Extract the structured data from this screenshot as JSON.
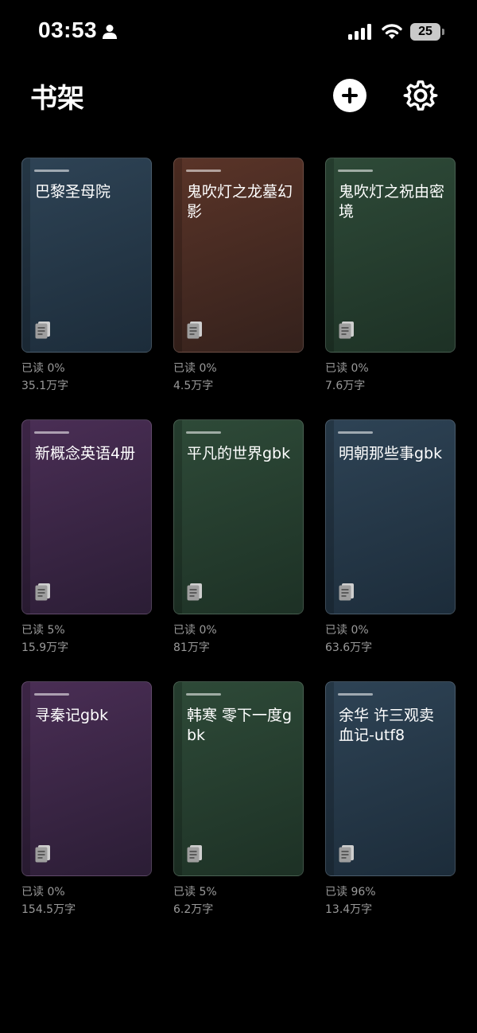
{
  "status_bar": {
    "time": "03:53",
    "battery": "25"
  },
  "header": {
    "title": "书架"
  },
  "books": [
    {
      "title": "巴黎圣母院",
      "progress": "已读 0%",
      "word_count": "35.1万字",
      "color": "blue"
    },
    {
      "title": "鬼吹灯之龙墓幻影",
      "progress": "已读 0%",
      "word_count": "4.5万字",
      "color": "brown"
    },
    {
      "title": "鬼吹灯之祝由密境",
      "progress": "已读 0%",
      "word_count": "7.6万字",
      "color": "green"
    },
    {
      "title": "新概念英语4册",
      "progress": "已读 5%",
      "word_count": "15.9万字",
      "color": "purple"
    },
    {
      "title": "平凡的世界gbk",
      "progress": "已读 0%",
      "word_count": "81万字",
      "color": "green"
    },
    {
      "title": "明朝那些事gbk",
      "progress": "已读 0%",
      "word_count": "63.6万字",
      "color": "blue"
    },
    {
      "title": "寻秦记gbk",
      "progress": "已读 0%",
      "word_count": "154.5万字",
      "color": "purple"
    },
    {
      "title": "韩寒 零下一度gbk",
      "progress": "已读 5%",
      "word_count": "6.2万字",
      "color": "green"
    },
    {
      "title": "余华 许三观卖血记-utf8",
      "progress": "已读 96%",
      "word_count": "13.4万字",
      "color": "blue"
    }
  ],
  "colors": {
    "blue": "#2e4355",
    "brown": "#5a3428",
    "green": "#2e4a38",
    "purple": "#4a2e55"
  }
}
